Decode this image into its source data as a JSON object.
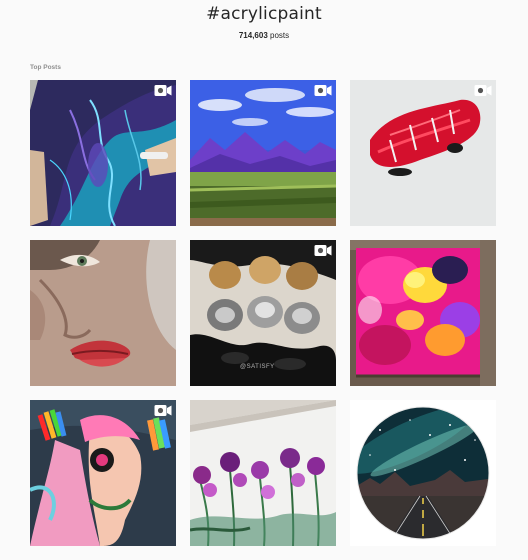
{
  "header": {
    "hashtag": "#acrylicpaint",
    "post_count": "714,603",
    "post_count_suffix": "posts"
  },
  "section": {
    "label": "Top Posts"
  },
  "posts": [
    {
      "id": "post-1",
      "subject": "purple-blue-fluid-pour",
      "has_video_icon": true
    },
    {
      "id": "post-2",
      "subject": "mountain-landscape",
      "has_video_icon": true
    },
    {
      "id": "post-3",
      "subject": "red-paint-blob",
      "has_video_icon": true
    },
    {
      "id": "post-4",
      "subject": "face-portrait-painting",
      "has_video_icon": false
    },
    {
      "id": "post-5",
      "subject": "metallic-paint-dollops",
      "has_video_icon": true,
      "watermark": "@SATISFY"
    },
    {
      "id": "post-6",
      "subject": "pink-yellow-abstract",
      "has_video_icon": false
    },
    {
      "id": "post-7",
      "subject": "rainbow-woman-painting",
      "has_video_icon": true
    },
    {
      "id": "post-8",
      "subject": "purple-flowers-painting",
      "has_video_icon": false
    },
    {
      "id": "post-9",
      "subject": "milky-way-road-circle",
      "has_video_icon": false
    }
  ],
  "colors": {
    "background": "#fafafa",
    "text": "#262626",
    "muted": "#8e8e8e",
    "icon": "#ffffff"
  }
}
